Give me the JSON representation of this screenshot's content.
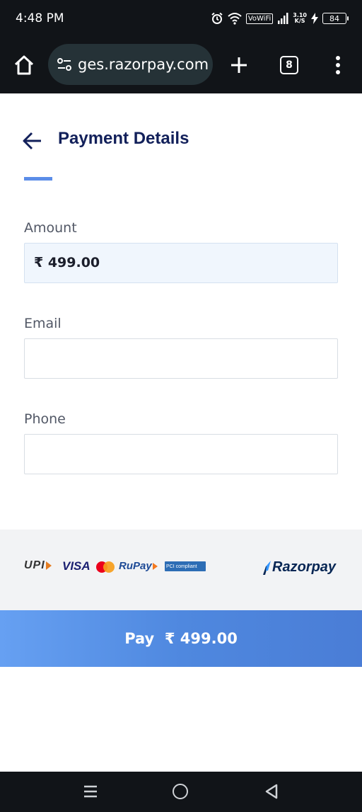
{
  "status_bar": {
    "time": "4:48 PM",
    "vowifi": "VoWiFi",
    "speed_value": "3.10",
    "speed_unit": "K/S",
    "battery": "84"
  },
  "browser": {
    "url": "ges.razorpay.com",
    "tab_count": "8"
  },
  "page": {
    "title": "Payment Details",
    "fields": {
      "amount": {
        "label": "Amount",
        "value": "₹ 499.00"
      },
      "email": {
        "label": "Email",
        "value": ""
      },
      "phone": {
        "label": "Phone",
        "value": ""
      }
    }
  },
  "footer": {
    "upi": "UPI",
    "visa": "VISA",
    "rupay": "RuPay",
    "pci": "PCI compliant",
    "brand": "Razorpay"
  },
  "pay_button": {
    "label": "Pay  ₹ 499.00"
  },
  "colors": {
    "title": "#12205a",
    "accent": "#5b8de8",
    "pay_button": "#5a92e8",
    "footer_bg": "#f2f3f5"
  }
}
